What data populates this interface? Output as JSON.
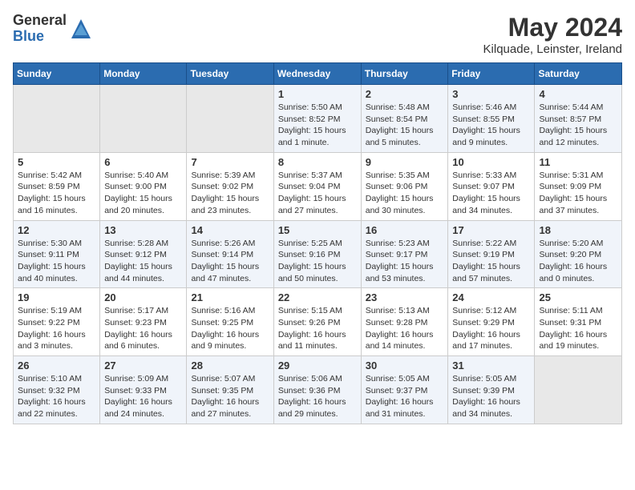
{
  "logo": {
    "general": "General",
    "blue": "Blue"
  },
  "title": "May 2024",
  "location": "Kilquade, Leinster, Ireland",
  "days_of_week": [
    "Sunday",
    "Monday",
    "Tuesday",
    "Wednesday",
    "Thursday",
    "Friday",
    "Saturday"
  ],
  "weeks": [
    [
      {
        "day": "",
        "info": ""
      },
      {
        "day": "",
        "info": ""
      },
      {
        "day": "",
        "info": ""
      },
      {
        "day": "1",
        "info": "Sunrise: 5:50 AM\nSunset: 8:52 PM\nDaylight: 15 hours\nand 1 minute."
      },
      {
        "day": "2",
        "info": "Sunrise: 5:48 AM\nSunset: 8:54 PM\nDaylight: 15 hours\nand 5 minutes."
      },
      {
        "day": "3",
        "info": "Sunrise: 5:46 AM\nSunset: 8:55 PM\nDaylight: 15 hours\nand 9 minutes."
      },
      {
        "day": "4",
        "info": "Sunrise: 5:44 AM\nSunset: 8:57 PM\nDaylight: 15 hours\nand 12 minutes."
      }
    ],
    [
      {
        "day": "5",
        "info": "Sunrise: 5:42 AM\nSunset: 8:59 PM\nDaylight: 15 hours\nand 16 minutes."
      },
      {
        "day": "6",
        "info": "Sunrise: 5:40 AM\nSunset: 9:00 PM\nDaylight: 15 hours\nand 20 minutes."
      },
      {
        "day": "7",
        "info": "Sunrise: 5:39 AM\nSunset: 9:02 PM\nDaylight: 15 hours\nand 23 minutes."
      },
      {
        "day": "8",
        "info": "Sunrise: 5:37 AM\nSunset: 9:04 PM\nDaylight: 15 hours\nand 27 minutes."
      },
      {
        "day": "9",
        "info": "Sunrise: 5:35 AM\nSunset: 9:06 PM\nDaylight: 15 hours\nand 30 minutes."
      },
      {
        "day": "10",
        "info": "Sunrise: 5:33 AM\nSunset: 9:07 PM\nDaylight: 15 hours\nand 34 minutes."
      },
      {
        "day": "11",
        "info": "Sunrise: 5:31 AM\nSunset: 9:09 PM\nDaylight: 15 hours\nand 37 minutes."
      }
    ],
    [
      {
        "day": "12",
        "info": "Sunrise: 5:30 AM\nSunset: 9:11 PM\nDaylight: 15 hours\nand 40 minutes."
      },
      {
        "day": "13",
        "info": "Sunrise: 5:28 AM\nSunset: 9:12 PM\nDaylight: 15 hours\nand 44 minutes."
      },
      {
        "day": "14",
        "info": "Sunrise: 5:26 AM\nSunset: 9:14 PM\nDaylight: 15 hours\nand 47 minutes."
      },
      {
        "day": "15",
        "info": "Sunrise: 5:25 AM\nSunset: 9:16 PM\nDaylight: 15 hours\nand 50 minutes."
      },
      {
        "day": "16",
        "info": "Sunrise: 5:23 AM\nSunset: 9:17 PM\nDaylight: 15 hours\nand 53 minutes."
      },
      {
        "day": "17",
        "info": "Sunrise: 5:22 AM\nSunset: 9:19 PM\nDaylight: 15 hours\nand 57 minutes."
      },
      {
        "day": "18",
        "info": "Sunrise: 5:20 AM\nSunset: 9:20 PM\nDaylight: 16 hours\nand 0 minutes."
      }
    ],
    [
      {
        "day": "19",
        "info": "Sunrise: 5:19 AM\nSunset: 9:22 PM\nDaylight: 16 hours\nand 3 minutes."
      },
      {
        "day": "20",
        "info": "Sunrise: 5:17 AM\nSunset: 9:23 PM\nDaylight: 16 hours\nand 6 minutes."
      },
      {
        "day": "21",
        "info": "Sunrise: 5:16 AM\nSunset: 9:25 PM\nDaylight: 16 hours\nand 9 minutes."
      },
      {
        "day": "22",
        "info": "Sunrise: 5:15 AM\nSunset: 9:26 PM\nDaylight: 16 hours\nand 11 minutes."
      },
      {
        "day": "23",
        "info": "Sunrise: 5:13 AM\nSunset: 9:28 PM\nDaylight: 16 hours\nand 14 minutes."
      },
      {
        "day": "24",
        "info": "Sunrise: 5:12 AM\nSunset: 9:29 PM\nDaylight: 16 hours\nand 17 minutes."
      },
      {
        "day": "25",
        "info": "Sunrise: 5:11 AM\nSunset: 9:31 PM\nDaylight: 16 hours\nand 19 minutes."
      }
    ],
    [
      {
        "day": "26",
        "info": "Sunrise: 5:10 AM\nSunset: 9:32 PM\nDaylight: 16 hours\nand 22 minutes."
      },
      {
        "day": "27",
        "info": "Sunrise: 5:09 AM\nSunset: 9:33 PM\nDaylight: 16 hours\nand 24 minutes."
      },
      {
        "day": "28",
        "info": "Sunrise: 5:07 AM\nSunset: 9:35 PM\nDaylight: 16 hours\nand 27 minutes."
      },
      {
        "day": "29",
        "info": "Sunrise: 5:06 AM\nSunset: 9:36 PM\nDaylight: 16 hours\nand 29 minutes."
      },
      {
        "day": "30",
        "info": "Sunrise: 5:05 AM\nSunset: 9:37 PM\nDaylight: 16 hours\nand 31 minutes."
      },
      {
        "day": "31",
        "info": "Sunrise: 5:05 AM\nSunset: 9:39 PM\nDaylight: 16 hours\nand 34 minutes."
      },
      {
        "day": "",
        "info": ""
      }
    ]
  ]
}
